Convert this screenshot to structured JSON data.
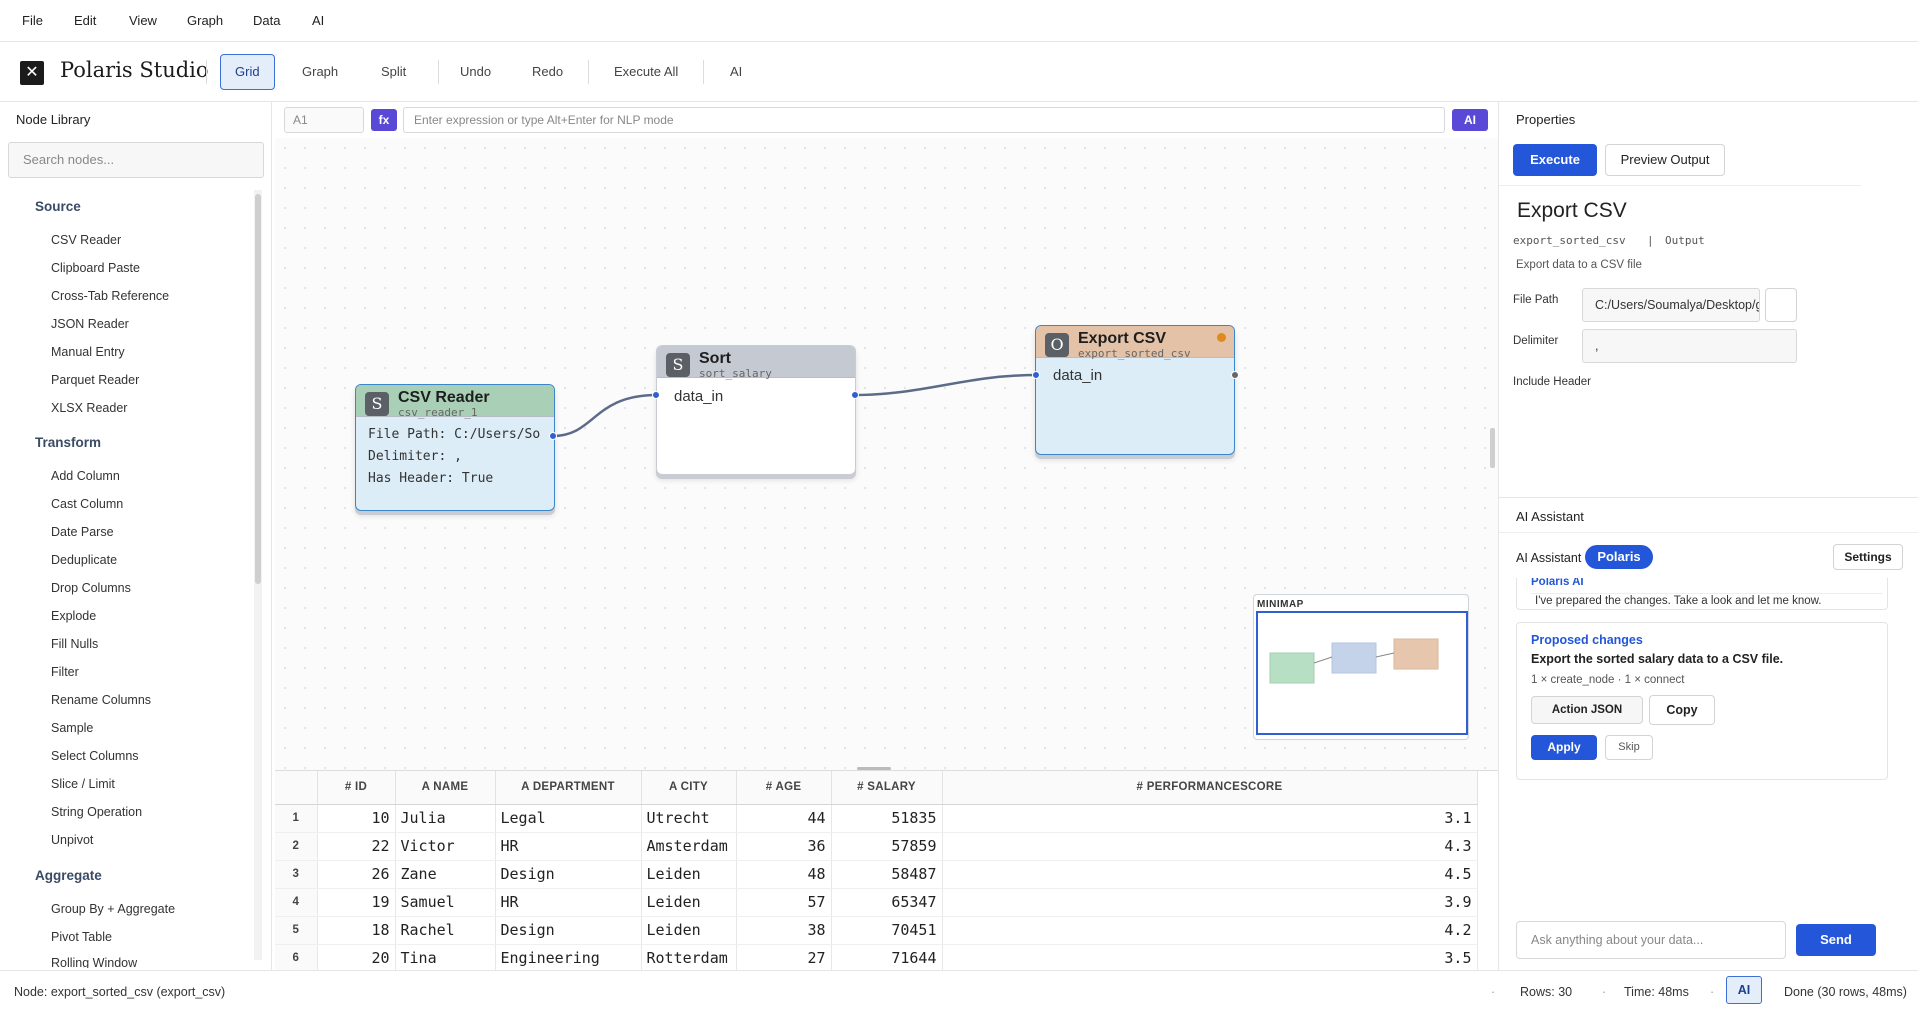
{
  "menu": [
    "File",
    "Edit",
    "View",
    "Graph",
    "Data",
    "AI"
  ],
  "app": {
    "logo_glyph": "✕",
    "title": "Polaris Studio"
  },
  "toolbar": {
    "grid": "Grid",
    "graph": "Graph",
    "split": "Split",
    "undo": "Undo",
    "redo": "Redo",
    "execute_all": "Execute All",
    "ai": "AI"
  },
  "library": {
    "title": "Node Library",
    "search_placeholder": "Search nodes...",
    "categories": [
      {
        "name": "Source",
        "items": [
          "CSV Reader",
          "Clipboard Paste",
          "Cross-Tab Reference",
          "JSON Reader",
          "Manual Entry",
          "Parquet Reader",
          "XLSX Reader"
        ]
      },
      {
        "name": "Transform",
        "items": [
          "Add Column",
          "Cast Column",
          "Date Parse",
          "Deduplicate",
          "Drop Columns",
          "Explode",
          "Fill Nulls",
          "Filter",
          "Rename Columns",
          "Sample",
          "Select Columns",
          "Slice / Limit",
          "String Operation",
          "Unpivot"
        ]
      },
      {
        "name": "Aggregate",
        "items": [
          "Group By + Aggregate",
          "Pivot Table",
          "Rolling Window"
        ]
      }
    ]
  },
  "expr": {
    "cell_ref": "A1",
    "fx": "fx",
    "placeholder": "Enter expression or type Alt+Enter for NLP mode",
    "ai": "AI"
  },
  "nodes": {
    "csv": {
      "badge": "S",
      "title": "CSV Reader",
      "id": "csv_reader_1",
      "lines": [
        "File Path: C:/Users/So",
        "Delimiter: ,",
        "Has Header: True"
      ],
      "header_color": "#a9cfb6"
    },
    "sort": {
      "badge": "S",
      "title": "Sort",
      "id": "sort_salary",
      "pin": "data_in",
      "header_color": "#c5c9d2"
    },
    "export": {
      "badge": "O",
      "title": "Export CSV",
      "id": "export_sorted_csv",
      "pin": "data_in",
      "header_color": "#e3c2a8",
      "status_color": "#e08a1e"
    }
  },
  "minimap": {
    "title": "MINIMAP"
  },
  "grid": {
    "columns": [
      "# ID",
      "A NAME",
      "A DEPARTMENT",
      "A CITY",
      "# AGE",
      "# SALARY",
      "# PERFORMANCESCORE"
    ],
    "rows": [
      [
        "1",
        "10",
        "Julia",
        "Legal",
        "Utrecht",
        "44",
        "51835",
        "3.1"
      ],
      [
        "2",
        "22",
        "Victor",
        "HR",
        "Amsterdam",
        "36",
        "57859",
        "4.3"
      ],
      [
        "3",
        "26",
        "Zane",
        "Design",
        "Leiden",
        "48",
        "58487",
        "4.5"
      ],
      [
        "4",
        "19",
        "Samuel",
        "HR",
        "Leiden",
        "57",
        "65347",
        "3.9"
      ],
      [
        "5",
        "18",
        "Rachel",
        "Design",
        "Leiden",
        "38",
        "70451",
        "4.2"
      ],
      [
        "6",
        "20",
        "Tina",
        "Engineering",
        "Rotterdam",
        "27",
        "71644",
        "3.5"
      ]
    ]
  },
  "properties": {
    "title": "Properties",
    "execute": "Execute",
    "preview": "Preview Output",
    "node_title": "Export CSV",
    "node_id": "export_sorted_csv",
    "sep": "|",
    "node_type": "Output",
    "description": "Export data to a CSV file",
    "file_path_label": "File Path",
    "file_path_value": "C:/Users/Soumalya/Desktop/githu",
    "delimiter_label": "Delimiter",
    "delimiter_value": ",",
    "include_header_label": "Include Header"
  },
  "assistant": {
    "section_title": "AI Assistant",
    "tab_label": "AI Assistant",
    "polaris": "Polaris",
    "settings": "Settings",
    "msg_sender": "Polaris AI",
    "msg_text": "I've prepared the changes. Take a look and let me know.",
    "proposed_title": "Proposed changes",
    "proposed_desc": "Export the sorted salary data to a CSV file.",
    "proposed_meta": "1 × create_node · 1 × connect",
    "action_json": "Action JSON",
    "copy": "Copy",
    "apply": "Apply",
    "skip": "Skip",
    "input_placeholder": "Ask anything about your data...",
    "send": "Send"
  },
  "status": {
    "node": "Node: export_sorted_csv (export_csv)",
    "rows": "Rows: 30",
    "time": "Time: 48ms",
    "ai": "AI",
    "done": "Done (30 rows, 48ms)"
  }
}
